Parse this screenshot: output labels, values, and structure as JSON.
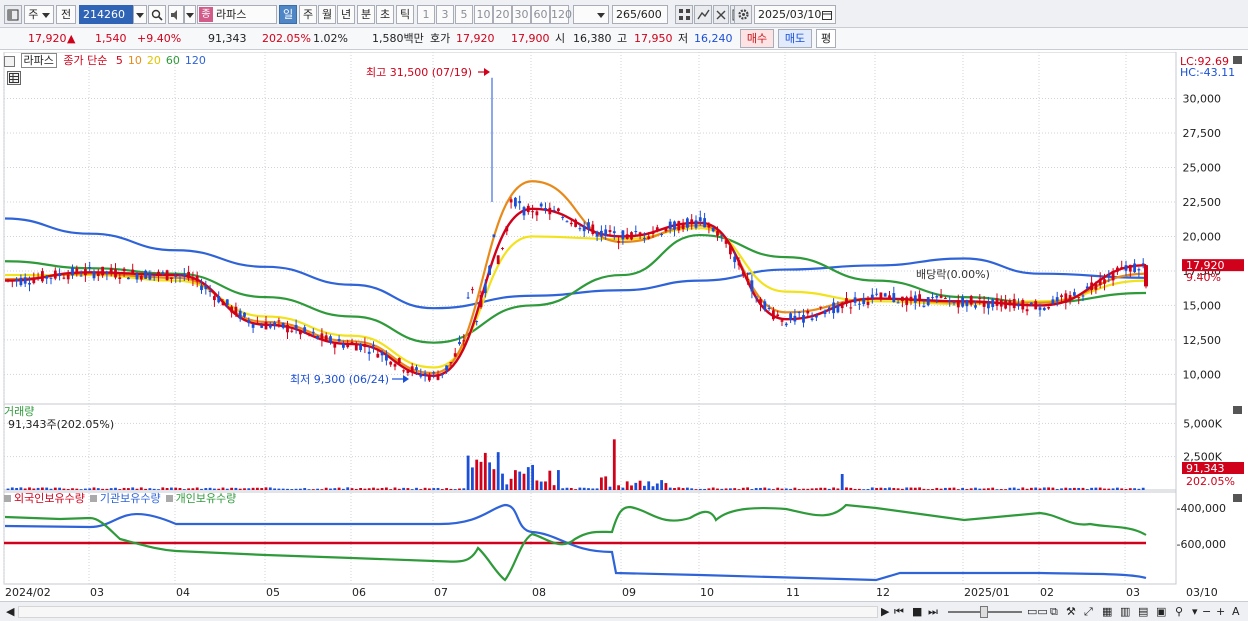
{
  "toolbar": {
    "period_label": "주",
    "prev_label": "전",
    "stock_code": "214260",
    "stock_name_tag": "종",
    "stock_name": "라파스",
    "period_buttons": [
      "일",
      "주",
      "월",
      "년",
      "분",
      "초",
      "틱"
    ],
    "active_period": "일",
    "interval_buttons": [
      "1",
      "3",
      "5",
      "10",
      "20",
      "30",
      "60",
      "120"
    ],
    "count_value": "265",
    "count_total": "/600",
    "date_value": "2025/03/10"
  },
  "quote": {
    "price": "17,920",
    "change_arrow": "▲",
    "change": "1,540",
    "change_pct": "+9.40%",
    "volume": "91,343",
    "volume_ratio": "202.05%",
    "turnover_pct": "1.02%",
    "amount": "1,580백만",
    "ask_label": "호가",
    "ask1": "17,920",
    "ask2": "17,900",
    "open_label": "시",
    "open": "16,380",
    "high_label": "고",
    "high": "17,950",
    "low_label": "저",
    "low": "16,240",
    "buy_label": "매수",
    "sell_label": "매도",
    "eval_label": "평"
  },
  "price_panel": {
    "legend_name": "라파스",
    "legend_type": "종가 단순",
    "ma_periods": [
      "5",
      "10",
      "20",
      "60",
      "120"
    ],
    "ma_colors": [
      "#d0021b",
      "#e88a1a",
      "#f2e21a",
      "#2e9a3a",
      "#2f63d8"
    ],
    "lc": "LC:92.69",
    "hc": "HC:-43.11",
    "high_annotation": "최고 31,500 (07/19)",
    "low_annotation": "최저 9,300 (06/24)",
    "dividend_label": "배당락(0.00%)",
    "current_price_tag": "17,920",
    "current_pct_tag": "9.40%",
    "y_ticks": [
      "30,000",
      "27,500",
      "25,000",
      "22,500",
      "20,000",
      "17,500",
      "15,000",
      "12,500",
      "10,000"
    ]
  },
  "volume_panel": {
    "title": "거래량",
    "current": "91,343주(202.05%)",
    "y_ticks": [
      "5,000K",
      "2,500K"
    ],
    "tag_value": "91,343",
    "tag_pct": "202.05%"
  },
  "holding_panel": {
    "legend": [
      "외국인보유수량",
      "기관보유수량",
      "개인보유수량"
    ],
    "legend_colors": [
      "#d0021b",
      "#2f63d8",
      "#2e9a3a"
    ],
    "y_ticks": [
      "-400,000",
      "-600,000"
    ]
  },
  "x_axis": [
    "2024/02",
    "03",
    "04",
    "05",
    "06",
    "07",
    "08",
    "09",
    "10",
    "11",
    "12",
    "2025/01",
    "02",
    "03",
    "03/10"
  ],
  "chart_data": {
    "type": "line",
    "title": "",
    "xlabel": "",
    "ylabel": "",
    "ylim": [
      8000,
      32500
    ],
    "x": [
      "2024/02",
      "03",
      "04",
      "05",
      "06",
      "07",
      "08",
      "09",
      "10",
      "11",
      "12",
      "2025/01",
      "02",
      "03"
    ],
    "series": [
      {
        "name": "5",
        "color": "#d0021b",
        "values": [
          16800,
          17400,
          17200,
          13600,
          12200,
          9900,
          22000,
          20000,
          21000,
          14000,
          15500,
          15300,
          15000,
          17920
        ]
      },
      {
        "name": "10",
        "color": "#e88a1a",
        "values": [
          16900,
          17300,
          17000,
          13800,
          12400,
          10100,
          24000,
          19600,
          20800,
          14500,
          15500,
          15200,
          15200,
          17300
        ]
      },
      {
        "name": "20",
        "color": "#f2e21a",
        "values": [
          17200,
          17200,
          16800,
          14200,
          12800,
          10500,
          20000,
          19800,
          20600,
          16000,
          15300,
          15100,
          15300,
          16800
        ]
      },
      {
        "name": "60",
        "color": "#2e9a3a",
        "values": [
          18200,
          17700,
          17300,
          15600,
          14200,
          12300,
          15000,
          17200,
          20100,
          18500,
          16800,
          15600,
          15200,
          15900
        ]
      },
      {
        "name": "120",
        "color": "#2f63d8",
        "values": [
          21300,
          20200,
          19000,
          17800,
          16500,
          14800,
          15700,
          16100,
          16800,
          17600,
          17900,
          18400,
          17300,
          17000
        ]
      }
    ],
    "high": {
      "value": 31500,
      "date": "07/19"
    },
    "low": {
      "value": 9300,
      "date": "06/24"
    }
  }
}
